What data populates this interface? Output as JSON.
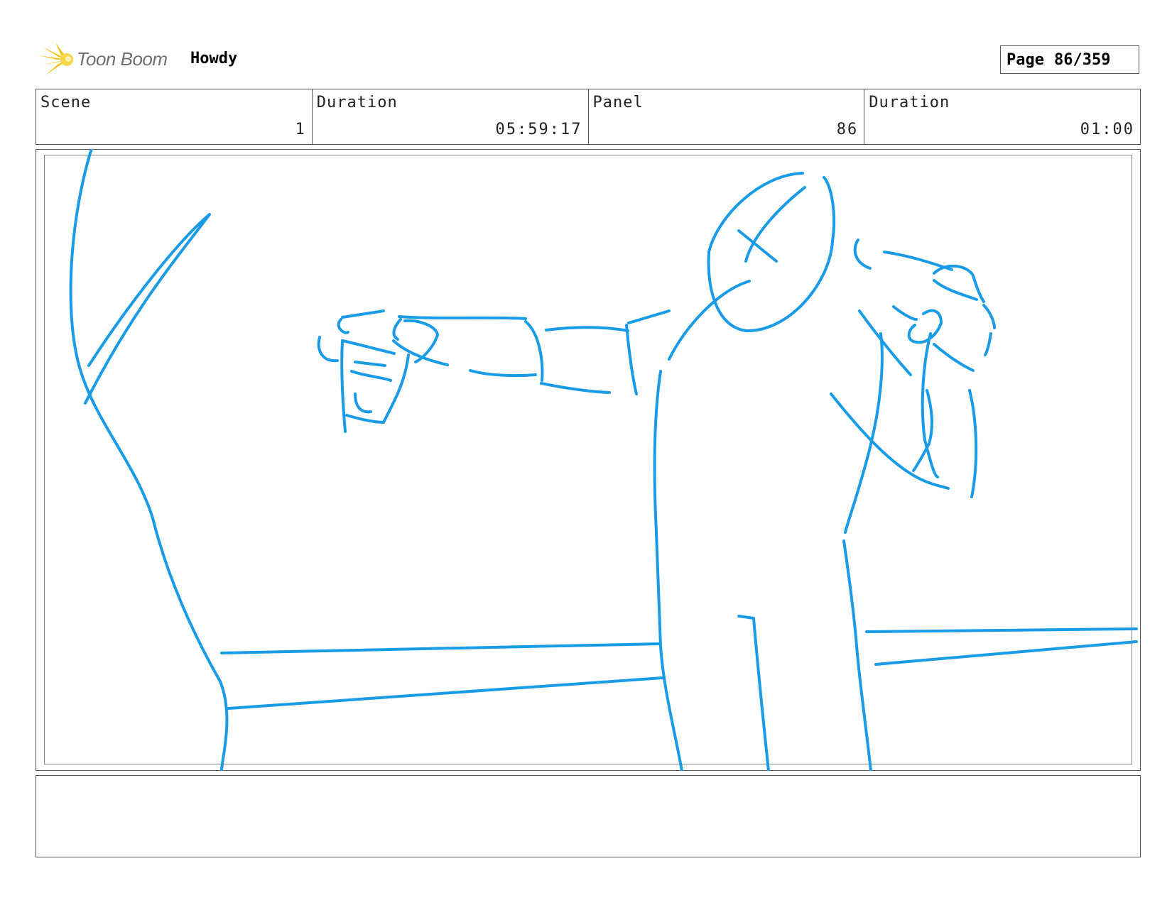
{
  "header": {
    "logo_text": "Toon Boom",
    "project_title": "Howdy",
    "page_label": "Page",
    "page_value": "86/359"
  },
  "info": {
    "scene_label": "Scene",
    "scene_value": "1",
    "scene_duration_label": "Duration",
    "scene_duration_value": "05:59:17",
    "panel_label": "Panel",
    "panel_value": "86",
    "panel_duration_label": "Duration",
    "panel_duration_value": "01:00"
  },
  "notes": {
    "text": ""
  },
  "colors": {
    "sketch_stroke": "#1a9be6",
    "logo_yellow": "#f5c518",
    "border": "#555555"
  }
}
